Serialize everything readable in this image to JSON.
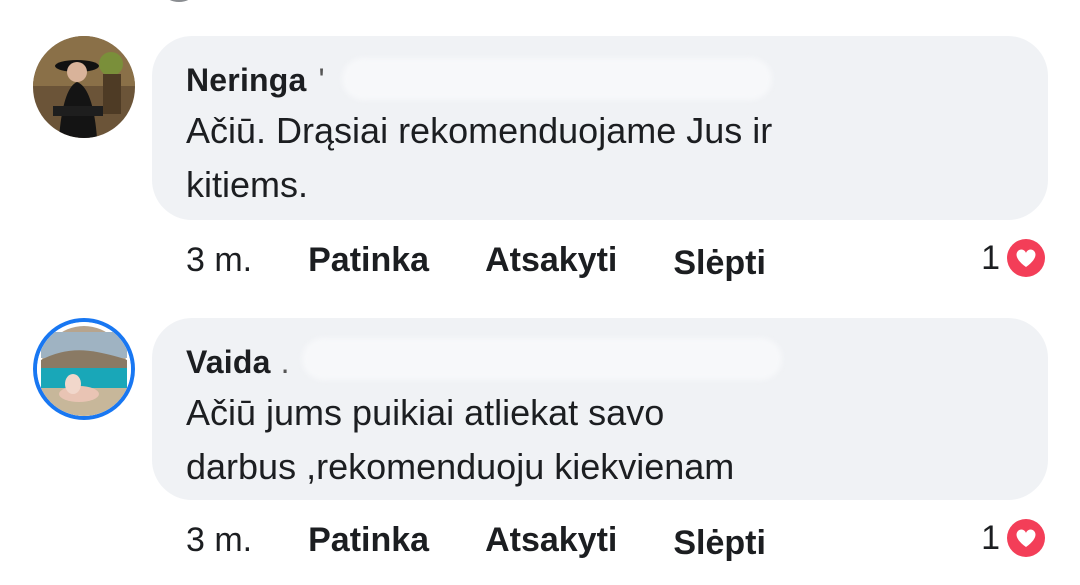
{
  "comments": [
    {
      "author": "Neringa",
      "author_suffix": "'",
      "lines": [
        "Ačiū. Drąsiai rekomenduojame Jus ir",
        "kitiems."
      ],
      "time": "3 m.",
      "actions": {
        "like": "Patinka",
        "reply": "Atsakyti",
        "hide": "Slėpti"
      },
      "reaction_count": "1",
      "reaction_icon": "heart-icon"
    },
    {
      "author": "Vaida",
      "author_suffix": ".",
      "lines": [
        "Ačiū jums puikiai atliekat savo",
        "darbus ,rekomenduoju kiekvienam"
      ],
      "time": "3 m.",
      "actions": {
        "like": "Patinka",
        "reply": "Atsakyti",
        "hide": "Slėpti"
      },
      "reaction_count": "1",
      "reaction_icon": "heart-icon"
    }
  ],
  "colors": {
    "bubble": "#f0f2f5",
    "heart": "#f33e58",
    "story_ring": "#1877f2"
  }
}
